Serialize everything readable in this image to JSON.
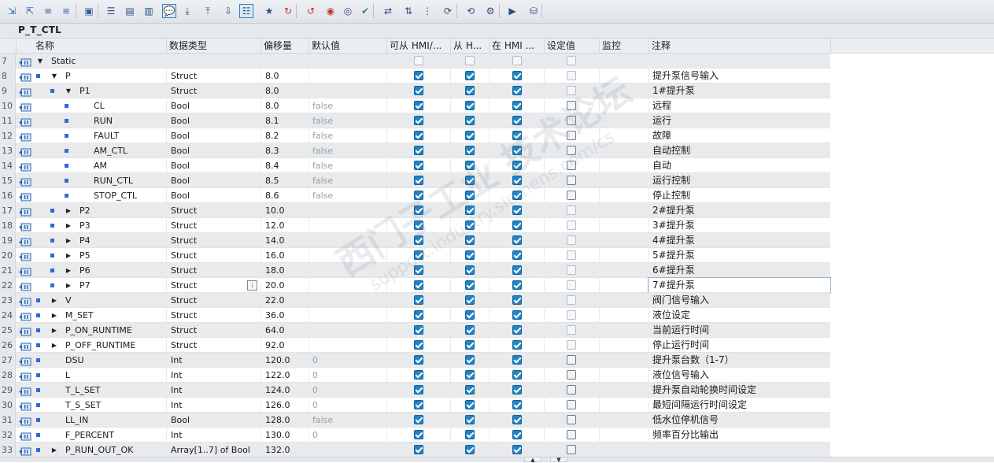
{
  "block_title": "P_T_CTL",
  "columns": {
    "name": "名称",
    "type": "数据类型",
    "offset": "偏移量",
    "default": "默认值",
    "hmi_access": "可从 HMI/...",
    "hmi_from": "从 H...",
    "hmi_in": "在 HMI ...",
    "setpoint": "设定值",
    "monitor": "监控",
    "comment": "注释"
  },
  "toolbar_icons": [
    "insert-row-icon",
    "add-row-icon",
    "expand-icon",
    "collapse-icon",
    "snapshot-icon",
    "view-table-icon",
    "view-block-icon",
    "view-memory-icon",
    "comment-toggle-icon",
    "download-icon",
    "upload-icon",
    "load-snapshot-icon",
    "all-members-icon",
    "favorites-icon",
    "go-online-icon",
    "go-offline-icon",
    "monitor-icon",
    "monitor-all-icon",
    "verify-icon",
    "set-value-icon",
    "sort-icon",
    "interface-icon",
    "refresh-icon",
    "sync-icon",
    "settings-icon",
    "compile-icon",
    "db-icon"
  ],
  "rows": [
    {
      "num": "7",
      "name": "Static",
      "type": "",
      "offset": "",
      "default": "",
      "hmi": [
        false,
        false,
        false
      ],
      "set": false,
      "comment": "",
      "level": 0,
      "expander": "open",
      "bullet": false,
      "grey": true,
      "section": true
    },
    {
      "num": "8",
      "name": "P",
      "type": "Struct",
      "offset": "8.0",
      "default": "",
      "hmi": [
        true,
        true,
        true
      ],
      "set": false,
      "comment": "提升泵信号输入",
      "level": 1,
      "expander": "open",
      "bullet": true,
      "grey": false
    },
    {
      "num": "9",
      "name": "P1",
      "type": "Struct",
      "offset": "8.0",
      "default": "",
      "hmi": [
        true,
        true,
        true
      ],
      "set": false,
      "comment": "1#提升泵",
      "level": 2,
      "expander": "open",
      "bullet": true,
      "grey": true
    },
    {
      "num": "10",
      "name": "CL",
      "type": "Bool",
      "offset": "8.0",
      "default": "false",
      "hmi": [
        true,
        true,
        true
      ],
      "set": true,
      "comment": "远程",
      "level": 3,
      "expander": "none",
      "bullet": true,
      "grey": false
    },
    {
      "num": "11",
      "name": "RUN",
      "type": "Bool",
      "offset": "8.1",
      "default": "false",
      "hmi": [
        true,
        true,
        true
      ],
      "set": true,
      "comment": "运行",
      "level": 3,
      "expander": "none",
      "bullet": true,
      "grey": true
    },
    {
      "num": "12",
      "name": "FAULT",
      "type": "Bool",
      "offset": "8.2",
      "default": "false",
      "hmi": [
        true,
        true,
        true
      ],
      "set": true,
      "comment": "故障",
      "level": 3,
      "expander": "none",
      "bullet": true,
      "grey": false
    },
    {
      "num": "13",
      "name": "AM_CTL",
      "type": "Bool",
      "offset": "8.3",
      "default": "false",
      "hmi": [
        true,
        true,
        true
      ],
      "set": true,
      "comment": "自动控制",
      "level": 3,
      "expander": "none",
      "bullet": true,
      "grey": true
    },
    {
      "num": "14",
      "name": "AM",
      "type": "Bool",
      "offset": "8.4",
      "default": "false",
      "hmi": [
        true,
        true,
        true
      ],
      "set": true,
      "comment": "自动",
      "level": 3,
      "expander": "none",
      "bullet": true,
      "grey": false
    },
    {
      "num": "15",
      "name": "RUN_CTL",
      "type": "Bool",
      "offset": "8.5",
      "default": "false",
      "hmi": [
        true,
        true,
        true
      ],
      "set": true,
      "comment": "运行控制",
      "level": 3,
      "expander": "none",
      "bullet": true,
      "grey": true
    },
    {
      "num": "16",
      "name": "STOP_CTL",
      "type": "Bool",
      "offset": "8.6",
      "default": "false",
      "hmi": [
        true,
        true,
        true
      ],
      "set": true,
      "comment": "停止控制",
      "level": 3,
      "expander": "none",
      "bullet": true,
      "grey": false
    },
    {
      "num": "17",
      "name": "P2",
      "type": "Struct",
      "offset": "10.0",
      "default": "",
      "hmi": [
        true,
        true,
        true
      ],
      "set": false,
      "comment": "2#提升泵",
      "level": 2,
      "expander": "closed",
      "bullet": true,
      "grey": true
    },
    {
      "num": "18",
      "name": "P3",
      "type": "Struct",
      "offset": "12.0",
      "default": "",
      "hmi": [
        true,
        true,
        true
      ],
      "set": false,
      "comment": "3#提升泵",
      "level": 2,
      "expander": "closed",
      "bullet": true,
      "grey": false
    },
    {
      "num": "19",
      "name": "P4",
      "type": "Struct",
      "offset": "14.0",
      "default": "",
      "hmi": [
        true,
        true,
        true
      ],
      "set": false,
      "comment": "4#提升泵",
      "level": 2,
      "expander": "closed",
      "bullet": true,
      "grey": true
    },
    {
      "num": "20",
      "name": "P5",
      "type": "Struct",
      "offset": "16.0",
      "default": "",
      "hmi": [
        true,
        true,
        true
      ],
      "set": false,
      "comment": "5#提升泵",
      "level": 2,
      "expander": "closed",
      "bullet": true,
      "grey": false
    },
    {
      "num": "21",
      "name": "P6",
      "type": "Struct",
      "offset": "18.0",
      "default": "",
      "hmi": [
        true,
        true,
        true
      ],
      "set": false,
      "comment": "6#提升泵",
      "level": 2,
      "expander": "closed",
      "bullet": true,
      "grey": true
    },
    {
      "num": "22",
      "name": "P7",
      "type": "Struct",
      "offset": "20.0",
      "default": "",
      "hmi": [
        true,
        true,
        true
      ],
      "set": false,
      "comment": "7#提升泵",
      "level": 2,
      "expander": "closed",
      "bullet": true,
      "grey": false,
      "editing": true
    },
    {
      "num": "23",
      "name": "V",
      "type": "Struct",
      "offset": "22.0",
      "default": "",
      "hmi": [
        true,
        true,
        true
      ],
      "set": false,
      "comment": "阀门信号输入",
      "level": 1,
      "expander": "closed",
      "bullet": true,
      "grey": true
    },
    {
      "num": "24",
      "name": "M_SET",
      "type": "Struct",
      "offset": "36.0",
      "default": "",
      "hmi": [
        true,
        true,
        true
      ],
      "set": false,
      "comment": "液位设定",
      "level": 1,
      "expander": "closed",
      "bullet": true,
      "grey": false
    },
    {
      "num": "25",
      "name": "P_ON_RUNTIME",
      "type": "Struct",
      "offset": "64.0",
      "default": "",
      "hmi": [
        true,
        true,
        true
      ],
      "set": false,
      "comment": "当前运行时间",
      "level": 1,
      "expander": "closed",
      "bullet": true,
      "grey": true
    },
    {
      "num": "26",
      "name": "P_OFF_RUNTIME",
      "type": "Struct",
      "offset": "92.0",
      "default": "",
      "hmi": [
        true,
        true,
        true
      ],
      "set": false,
      "comment": "停止运行时间",
      "level": 1,
      "expander": "closed",
      "bullet": true,
      "grey": false
    },
    {
      "num": "27",
      "name": "DSU",
      "type": "Int",
      "offset": "120.0",
      "default": "0",
      "hmi": [
        true,
        true,
        true
      ],
      "set": true,
      "comment": "提升泵台数（1-7）",
      "level": 1,
      "expander": "none",
      "bullet": true,
      "grey": true
    },
    {
      "num": "28",
      "name": "L",
      "type": "Int",
      "offset": "122.0",
      "default": "0",
      "hmi": [
        true,
        true,
        true
      ],
      "set": true,
      "comment": "液位信号输入",
      "level": 1,
      "expander": "none",
      "bullet": true,
      "grey": false
    },
    {
      "num": "29",
      "name": "T_L_SET",
      "type": "Int",
      "offset": "124.0",
      "default": "0",
      "hmi": [
        true,
        true,
        true
      ],
      "set": true,
      "comment": "提升泵自动轮换时间设定",
      "level": 1,
      "expander": "none",
      "bullet": true,
      "grey": true
    },
    {
      "num": "30",
      "name": "T_S_SET",
      "type": "Int",
      "offset": "126.0",
      "default": "0",
      "hmi": [
        true,
        true,
        true
      ],
      "set": true,
      "comment": "最短间隔运行时间设定",
      "level": 1,
      "expander": "none",
      "bullet": true,
      "grey": false
    },
    {
      "num": "31",
      "name": "LL_IN",
      "type": "Bool",
      "offset": "128.0",
      "default": "false",
      "hmi": [
        true,
        true,
        true
      ],
      "set": true,
      "comment": "低水位停机信号",
      "level": 1,
      "expander": "none",
      "bullet": true,
      "grey": true
    },
    {
      "num": "32",
      "name": "F_PERCENT",
      "type": "Int",
      "offset": "130.0",
      "default": "0",
      "hmi": [
        true,
        true,
        true
      ],
      "set": true,
      "comment": "频率百分比输出",
      "level": 1,
      "expander": "none",
      "bullet": true,
      "grey": false
    },
    {
      "num": "33",
      "name": "P_RUN_OUT_OK",
      "type": "Array[1..7] of Bool",
      "offset": "132.0",
      "default": "",
      "hmi": [
        true,
        true,
        true
      ],
      "set": true,
      "comment": "",
      "level": 1,
      "expander": "closed",
      "bullet": true,
      "grey": true
    }
  ],
  "colors": {
    "accent": "#2b6cd1",
    "checkbox_on": "#1f84c8",
    "row_grey": "#e8eaec"
  },
  "watermark": {
    "line1": "西门子工业 技术论坛",
    "line2": "support.industry.siemens.com/cs"
  }
}
